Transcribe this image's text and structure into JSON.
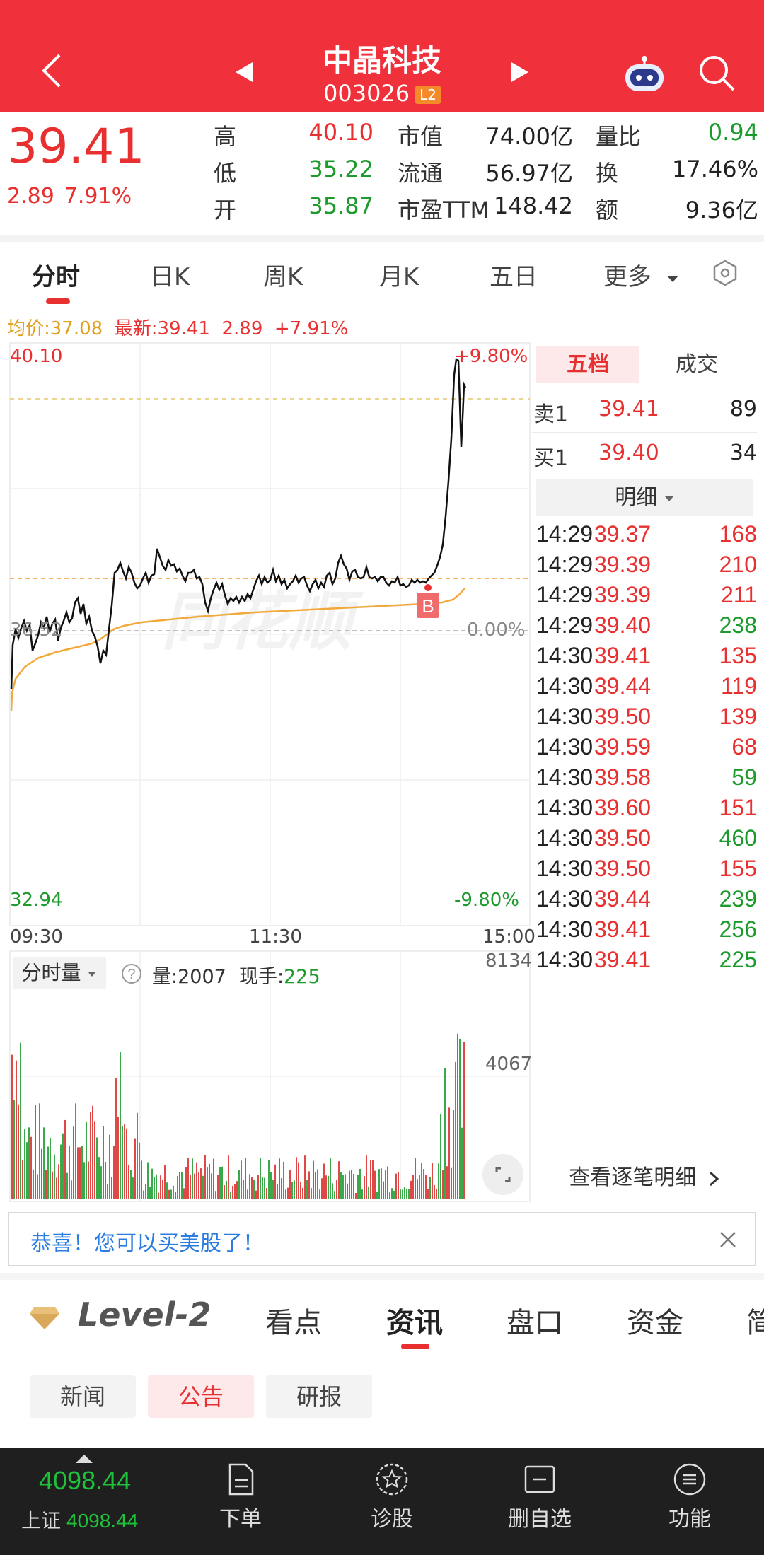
{
  "header": {
    "title": "中晶科技",
    "code": "003026",
    "badge": "L2"
  },
  "quote": {
    "price": "39.41",
    "change": "2.89",
    "change_pct": "7.91%",
    "rows": [
      {
        "l1": "高",
        "v1": "40.10",
        "l2": "市值",
        "v2": "74.00亿",
        "l3": "量比",
        "v3": "0.94"
      },
      {
        "l1": "低",
        "v1": "35.22",
        "l2": "流通",
        "v2": "56.97亿",
        "l3": "换",
        "v3": "17.46%"
      },
      {
        "l1": "开",
        "v1": "35.87",
        "l2": "市盈TTM",
        "v2": "148.42",
        "l3": "额",
        "v3": "9.36亿"
      }
    ]
  },
  "tabs": [
    "分时",
    "日K",
    "周K",
    "月K",
    "五日",
    "更多"
  ],
  "intraday": {
    "avg_label": "均价:37.08",
    "latest_label": "最新:39.41",
    "change": "2.89",
    "pct": "+7.91%",
    "high": "40.10",
    "high_pct": "+9.80%",
    "prev_close": "36.52",
    "zero_pct": "0.00%",
    "low": "32.94",
    "low_pct": "-9.80%",
    "t_start": "09:30",
    "t_mid": "11:30",
    "t_end": "15:00",
    "watermark": "同花顺",
    "marker": "B"
  },
  "volume": {
    "select_label": "分时量",
    "vol_label": "量:2007",
    "now_label": "现手:",
    "now_value": "225",
    "max": "8134",
    "mid": "4067"
  },
  "side": {
    "tab_active": "五档",
    "tab_other": "成交",
    "sell1": {
      "label": "卖1",
      "price": "39.41",
      "vol": "89"
    },
    "buy1": {
      "label": "买1",
      "price": "39.40",
      "vol": "34"
    },
    "detail_btn": "明细",
    "trades": [
      {
        "t": "14:29",
        "p": "39.37",
        "v": "168",
        "c": "red"
      },
      {
        "t": "14:29",
        "p": "39.39",
        "v": "210",
        "c": "red"
      },
      {
        "t": "14:29",
        "p": "39.39",
        "v": "211",
        "c": "red"
      },
      {
        "t": "14:29",
        "p": "39.40",
        "v": "238",
        "c": "green"
      },
      {
        "t": "14:30",
        "p": "39.41",
        "v": "135",
        "c": "red"
      },
      {
        "t": "14:30",
        "p": "39.44",
        "v": "119",
        "c": "red"
      },
      {
        "t": "14:30",
        "p": "39.50",
        "v": "139",
        "c": "red"
      },
      {
        "t": "14:30",
        "p": "39.59",
        "v": "68",
        "c": "red"
      },
      {
        "t": "14:30",
        "p": "39.58",
        "v": "59",
        "c": "green"
      },
      {
        "t": "14:30",
        "p": "39.60",
        "v": "151",
        "c": "red"
      },
      {
        "t": "14:30",
        "p": "39.50",
        "v": "460",
        "c": "green"
      },
      {
        "t": "14:30",
        "p": "39.50",
        "v": "155",
        "c": "red"
      },
      {
        "t": "14:30",
        "p": "39.44",
        "v": "239",
        "c": "green"
      },
      {
        "t": "14:30",
        "p": "39.41",
        "v": "256",
        "c": "green"
      },
      {
        "t": "14:30",
        "p": "39.41",
        "v": "225",
        "c": "green"
      }
    ],
    "see_all": "查看逐笔明细"
  },
  "banner": {
    "text": "恭喜！您可以买美股了！"
  },
  "sections": {
    "level2": "Level-2",
    "tabs": [
      "看点",
      "资讯",
      "盘口",
      "资金",
      "简"
    ]
  },
  "chips": [
    "新闻",
    "公告",
    "研报"
  ],
  "bottom": {
    "index_value": "4098.44",
    "index_name": "上证",
    "index_value2": "4098.44",
    "items": [
      "下单",
      "诊股",
      "删自选",
      "功能"
    ]
  },
  "colors": {
    "brand": "#f0313b",
    "up": "#e93030",
    "down": "#1d9a2c",
    "avg_line": "#f2a93b"
  }
}
